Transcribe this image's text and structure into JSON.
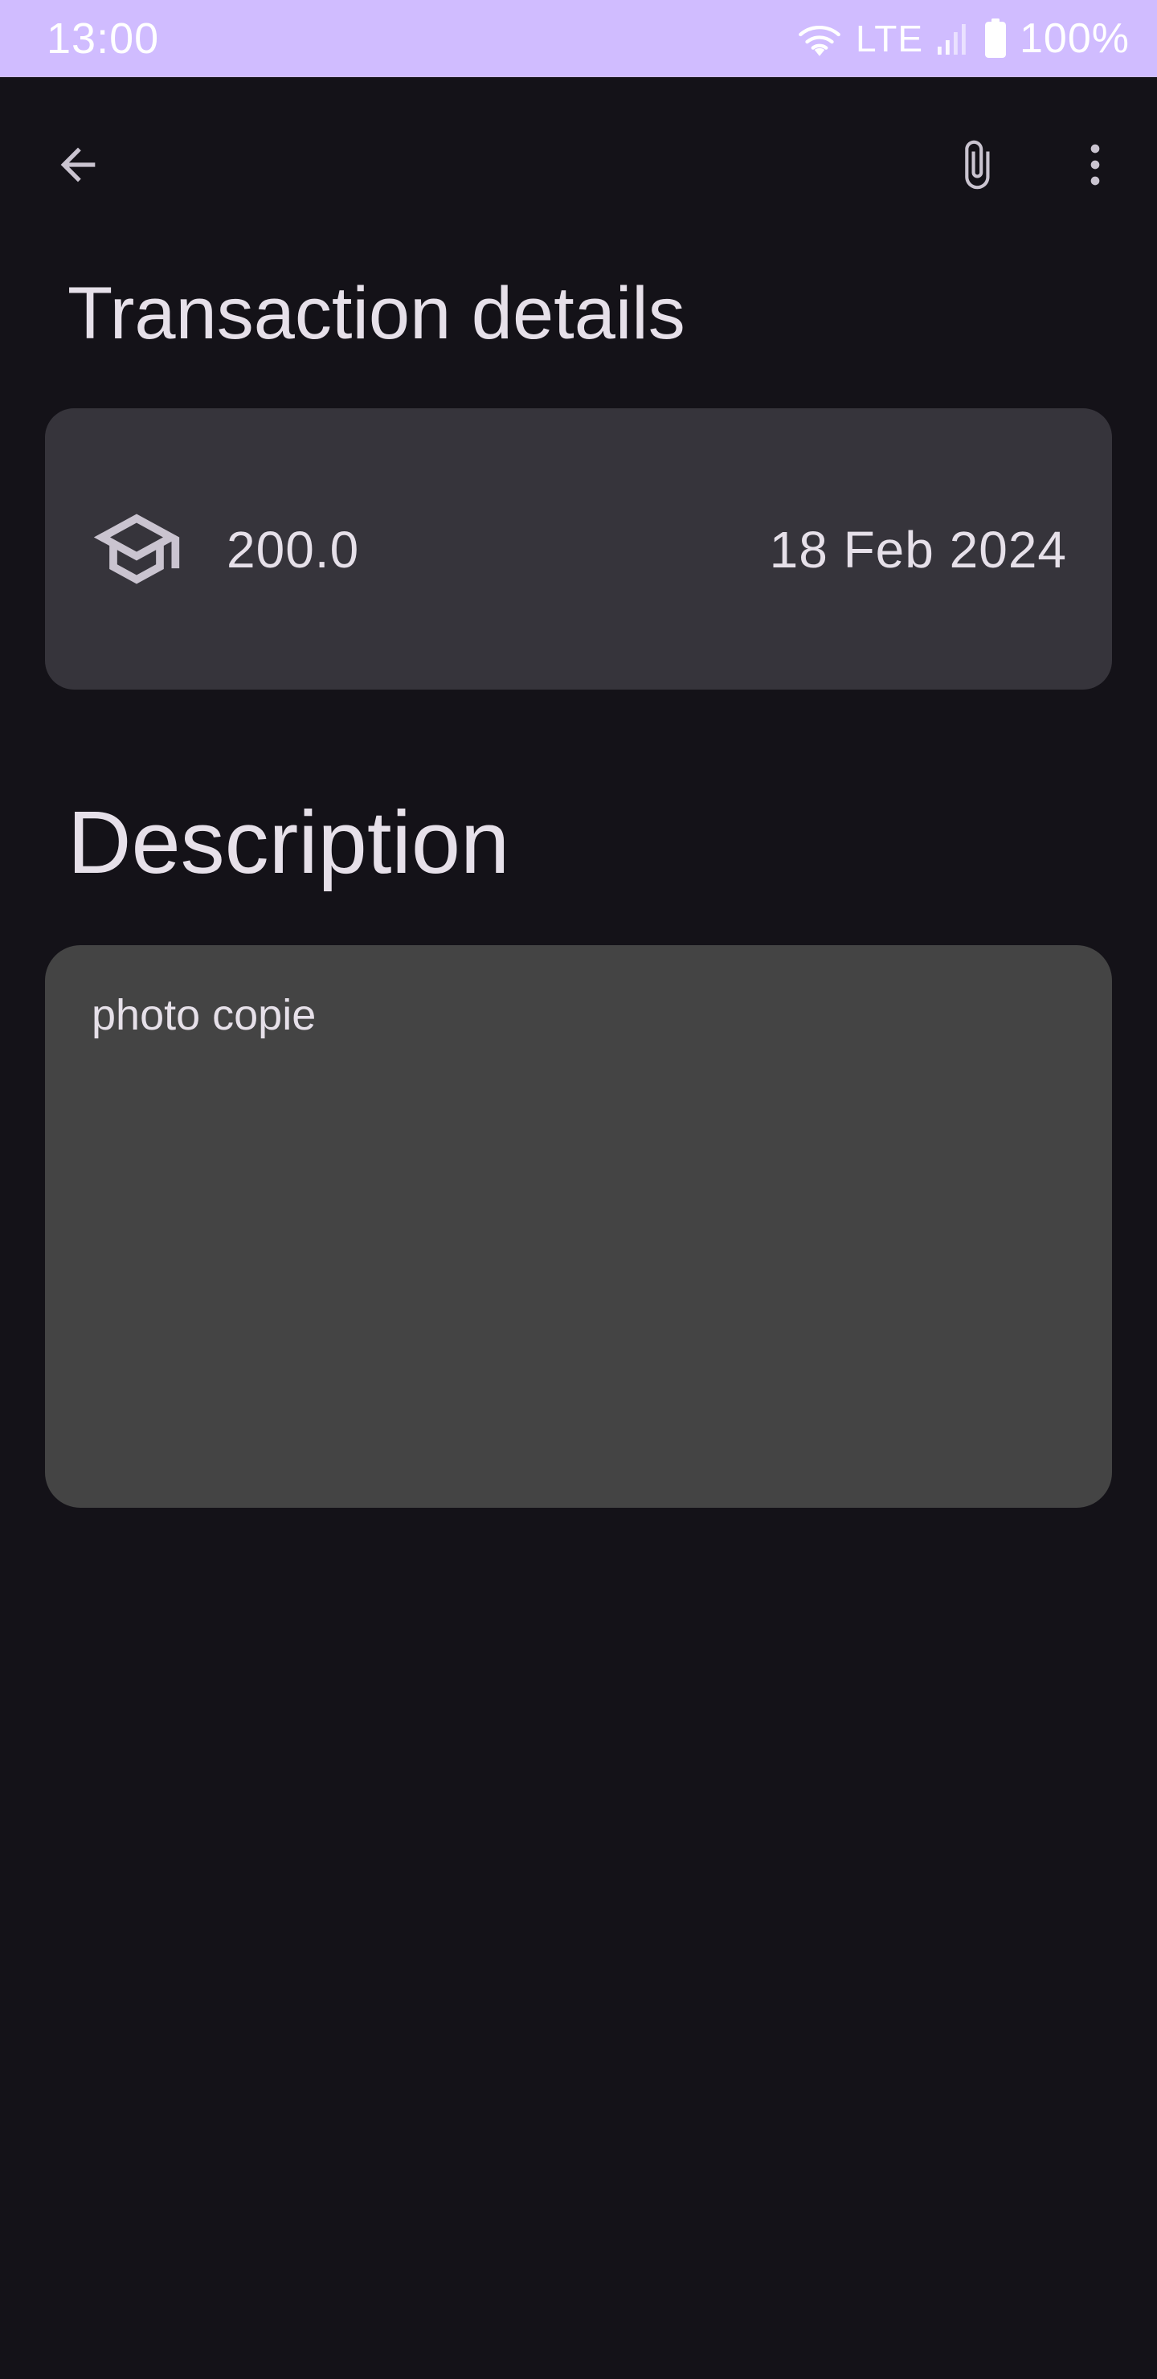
{
  "status_bar": {
    "time": "13:00",
    "network": "LTE",
    "battery": "100%"
  },
  "app_bar": {
    "back_icon": "arrow-back-icon",
    "attach_icon": "paperclip-icon",
    "more_icon": "more-vert-icon"
  },
  "page": {
    "title": "Transaction details"
  },
  "transaction": {
    "category_icon": "graduation-cap-icon",
    "amount": "200.0",
    "date": "18 Feb 2024"
  },
  "description": {
    "heading": "Description",
    "text": "photo copie"
  },
  "colors": {
    "status_bar_bg": "#D0BCFF",
    "background": "#141218",
    "card_bg": "#36343B",
    "description_bg": "#444444",
    "text": "#E6E0E9",
    "icon": "#CAC4D0"
  }
}
